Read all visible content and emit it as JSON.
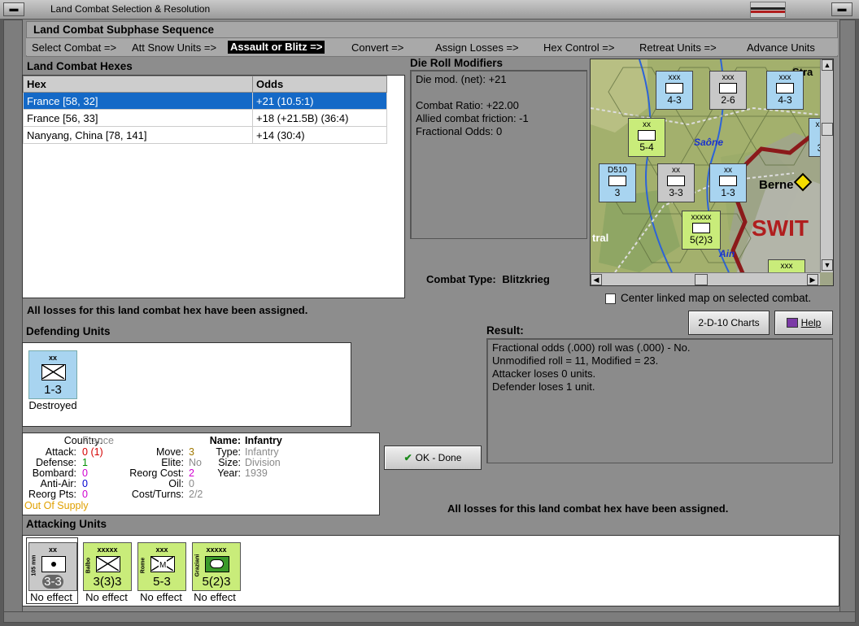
{
  "window": {
    "title": "Land Combat Selection & Resolution"
  },
  "subphase": {
    "heading": "Land Combat Subphase Sequence",
    "steps": [
      "Select Combat =>",
      "Att Snow Units =>",
      "Assault or Blitz =>",
      "Convert =>",
      "Assign Losses =>",
      "Hex Control =>",
      "Retreat Units =>",
      "Advance Units"
    ],
    "active_index": 2
  },
  "hexes": {
    "heading": "Land Combat Hexes",
    "col_hex": "Hex",
    "col_odds": "Odds",
    "rows": [
      {
        "hex": "France [58, 32]",
        "odds": "+21 (10.5:1)"
      },
      {
        "hex": "France [56, 33]",
        "odds": "+18 (+21.5B) (36:4)"
      },
      {
        "hex": "Nanyang, China [78, 141]",
        "odds": "+14 (30:4)"
      }
    ],
    "selected_index": 0
  },
  "modifiers": {
    "heading": "Die Roll Modifiers",
    "lines": [
      "Die mod. (net): +21",
      "",
      "Combat Ratio: +22.00",
      "Allied combat friction: -1",
      "Fractional Odds: 0"
    ]
  },
  "combat_type": {
    "label": "Combat Type:",
    "value": "Blitzkrieg"
  },
  "map": {
    "labels": {
      "saone": "Saône",
      "berne": "Berne",
      "switz": "SWIT",
      "ain": "Ain",
      "tral": "tral",
      "stra": "Stra"
    },
    "center_checkbox": "Center linked map on selected combat.",
    "center_checked": false
  },
  "status_assigned": "All losses for this land combat hex have been assigned.",
  "status_assigned_2": "All losses for this land combat hex have been assigned.",
  "defending": {
    "heading": "Defending Units",
    "units": [
      {
        "size": "xx",
        "strength": "1-3",
        "result": "Destroyed"
      }
    ]
  },
  "result": {
    "heading": "Result:",
    "lines": [
      "Fractional odds (.000) roll was (.000)  - No.",
      "Unmodified roll = 11, Modified = 23.",
      "Attacker loses 0 units.",
      "Defender loses 1 unit."
    ]
  },
  "buttons": {
    "charts": "2-D-10 Charts",
    "help": "Help",
    "ok": "OK - Done"
  },
  "unit_info": {
    "country_label": "Country:",
    "country": "France",
    "attack_label": "Attack:",
    "attack": "0",
    "attack_mod": "(1)",
    "defense_label": "Defense:",
    "defense": "1",
    "bombard_label": "Bombard:",
    "bombard": "0",
    "antiair_label": "Anti-Air:",
    "antiair": "0",
    "reorg_label": "Reorg Pts:",
    "reorg": "0",
    "supply": "Out Of Supply",
    "move_label": "Move:",
    "move": "3",
    "elite_label": "Elite:",
    "elite": "No",
    "reorgcost_label": "Reorg Cost:",
    "reorgcost": "2",
    "oil_label": "Oil:",
    "oil": "0",
    "costturns_label": "Cost/Turns:",
    "costturns": "2/2",
    "name_label": "Name:",
    "name": "Infantry",
    "type_label": "Type:",
    "type": "Infantry",
    "size_label": "Size:",
    "size": "Division",
    "year_label": "Year:",
    "year": "1939"
  },
  "attacking": {
    "heading": "Attacking Units",
    "units": [
      {
        "size": "xx",
        "name": "105 mm",
        "strength": "3-3",
        "result": "No effect",
        "color": "#c8c8c8"
      },
      {
        "size": "xxxxx",
        "name": "Balbo",
        "strength": "3(3)3",
        "result": "No effect",
        "color": "#c9ec7a"
      },
      {
        "size": "xxx",
        "name": "Rome",
        "strength": "5-3",
        "result": "No effect",
        "color": "#c9ec7a"
      },
      {
        "size": "xxxxx",
        "name": "Graziani",
        "strength": "5(2)3",
        "result": "No effect",
        "color": "#c9ec7a"
      }
    ]
  },
  "colors": {
    "selection": "#1469c7",
    "allied": "#a8d4f0",
    "italian": "#c9ec7a",
    "neutral_border": "#8b1a1a"
  }
}
